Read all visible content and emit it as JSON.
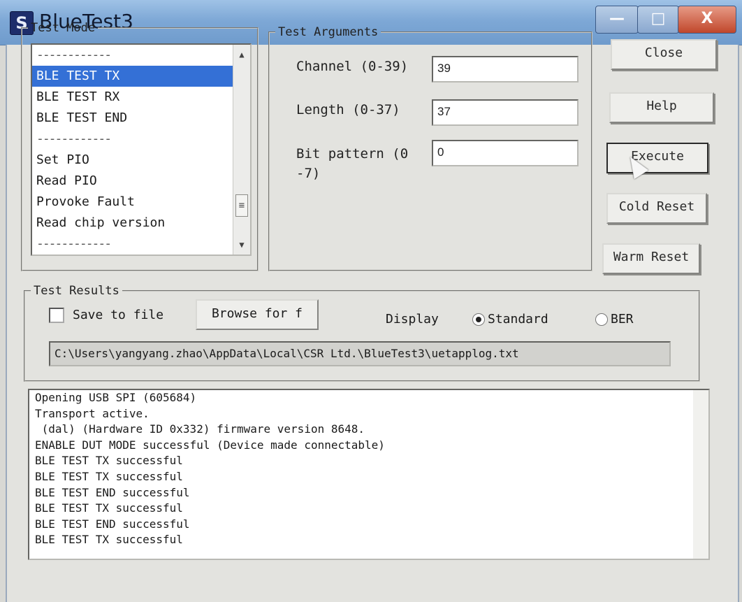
{
  "window": {
    "title": "BlueTest3",
    "icon": "S",
    "min_glyph": "—",
    "max_glyph": "□",
    "close_glyph": "X"
  },
  "test_mode": {
    "legend": "Test Mode",
    "items": [
      {
        "label": "------------",
        "sep": true
      },
      {
        "label": "BLE TEST TX",
        "selected": true
      },
      {
        "label": "BLE TEST RX"
      },
      {
        "label": "BLE TEST END"
      },
      {
        "label": "------------",
        "sep": true
      },
      {
        "label": "Set PIO"
      },
      {
        "label": "Read PIO"
      },
      {
        "label": "Provoke Fault"
      },
      {
        "label": "Read chip version"
      },
      {
        "label": "------------",
        "sep": true
      }
    ]
  },
  "test_arguments": {
    "legend": "Test Arguments",
    "channel_label": "Channel (0-39)",
    "channel_value": "39",
    "length_label": "Length (0-37)",
    "length_value": "37",
    "bit_label": "Bit pattern (0 -7)",
    "bit_value": "0"
  },
  "buttons": {
    "close": "Close",
    "help": "Help",
    "execute": "Execute",
    "cold_reset": "Cold Reset",
    "warm_reset": "Warm Reset"
  },
  "test_results": {
    "legend": "Test Results",
    "save_to_file": "Save to file",
    "save_checked": false,
    "browse": "Browse for f",
    "display_label": "Display",
    "radio_standard": "Standard",
    "radio_ber": "BER",
    "selected_display": "Standard",
    "path": "C:\\Users\\yangyang.zhao\\AppData\\Local\\CSR Ltd.\\BlueTest3\\uetapplog.txt"
  },
  "log_lines": [
    "Opening USB SPI (605684)",
    "Transport active.",
    " (dal) (Hardware ID 0x332) firmware version 8648.",
    "ENABLE DUT MODE successful (Device made connectable)",
    "BLE TEST TX successful",
    "BLE TEST TX successful",
    "BLE TEST END successful",
    "BLE TEST TX successful",
    "BLE TEST END successful",
    "BLE TEST TX successful"
  ],
  "colors": {
    "selection": "#3470d6",
    "titlebar": "#7ea8d6",
    "close_button": "#c0472b"
  }
}
